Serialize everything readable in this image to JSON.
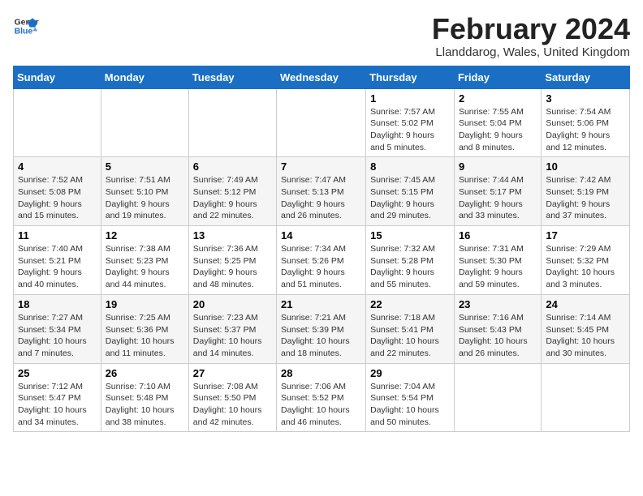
{
  "header": {
    "logo_general": "General",
    "logo_blue": "Blue",
    "month_title": "February 2024",
    "location": "Llanddarog, Wales, United Kingdom"
  },
  "weekdays": [
    "Sunday",
    "Monday",
    "Tuesday",
    "Wednesday",
    "Thursday",
    "Friday",
    "Saturday"
  ],
  "weeks": [
    [
      {
        "day": "",
        "info": ""
      },
      {
        "day": "",
        "info": ""
      },
      {
        "day": "",
        "info": ""
      },
      {
        "day": "",
        "info": ""
      },
      {
        "day": "1",
        "info": "Sunrise: 7:57 AM\nSunset: 5:02 PM\nDaylight: 9 hours\nand 5 minutes."
      },
      {
        "day": "2",
        "info": "Sunrise: 7:55 AM\nSunset: 5:04 PM\nDaylight: 9 hours\nand 8 minutes."
      },
      {
        "day": "3",
        "info": "Sunrise: 7:54 AM\nSunset: 5:06 PM\nDaylight: 9 hours\nand 12 minutes."
      }
    ],
    [
      {
        "day": "4",
        "info": "Sunrise: 7:52 AM\nSunset: 5:08 PM\nDaylight: 9 hours\nand 15 minutes."
      },
      {
        "day": "5",
        "info": "Sunrise: 7:51 AM\nSunset: 5:10 PM\nDaylight: 9 hours\nand 19 minutes."
      },
      {
        "day": "6",
        "info": "Sunrise: 7:49 AM\nSunset: 5:12 PM\nDaylight: 9 hours\nand 22 minutes."
      },
      {
        "day": "7",
        "info": "Sunrise: 7:47 AM\nSunset: 5:13 PM\nDaylight: 9 hours\nand 26 minutes."
      },
      {
        "day": "8",
        "info": "Sunrise: 7:45 AM\nSunset: 5:15 PM\nDaylight: 9 hours\nand 29 minutes."
      },
      {
        "day": "9",
        "info": "Sunrise: 7:44 AM\nSunset: 5:17 PM\nDaylight: 9 hours\nand 33 minutes."
      },
      {
        "day": "10",
        "info": "Sunrise: 7:42 AM\nSunset: 5:19 PM\nDaylight: 9 hours\nand 37 minutes."
      }
    ],
    [
      {
        "day": "11",
        "info": "Sunrise: 7:40 AM\nSunset: 5:21 PM\nDaylight: 9 hours\nand 40 minutes."
      },
      {
        "day": "12",
        "info": "Sunrise: 7:38 AM\nSunset: 5:23 PM\nDaylight: 9 hours\nand 44 minutes."
      },
      {
        "day": "13",
        "info": "Sunrise: 7:36 AM\nSunset: 5:25 PM\nDaylight: 9 hours\nand 48 minutes."
      },
      {
        "day": "14",
        "info": "Sunrise: 7:34 AM\nSunset: 5:26 PM\nDaylight: 9 hours\nand 51 minutes."
      },
      {
        "day": "15",
        "info": "Sunrise: 7:32 AM\nSunset: 5:28 PM\nDaylight: 9 hours\nand 55 minutes."
      },
      {
        "day": "16",
        "info": "Sunrise: 7:31 AM\nSunset: 5:30 PM\nDaylight: 9 hours\nand 59 minutes."
      },
      {
        "day": "17",
        "info": "Sunrise: 7:29 AM\nSunset: 5:32 PM\nDaylight: 10 hours\nand 3 minutes."
      }
    ],
    [
      {
        "day": "18",
        "info": "Sunrise: 7:27 AM\nSunset: 5:34 PM\nDaylight: 10 hours\nand 7 minutes."
      },
      {
        "day": "19",
        "info": "Sunrise: 7:25 AM\nSunset: 5:36 PM\nDaylight: 10 hours\nand 11 minutes."
      },
      {
        "day": "20",
        "info": "Sunrise: 7:23 AM\nSunset: 5:37 PM\nDaylight: 10 hours\nand 14 minutes."
      },
      {
        "day": "21",
        "info": "Sunrise: 7:21 AM\nSunset: 5:39 PM\nDaylight: 10 hours\nand 18 minutes."
      },
      {
        "day": "22",
        "info": "Sunrise: 7:18 AM\nSunset: 5:41 PM\nDaylight: 10 hours\nand 22 minutes."
      },
      {
        "day": "23",
        "info": "Sunrise: 7:16 AM\nSunset: 5:43 PM\nDaylight: 10 hours\nand 26 minutes."
      },
      {
        "day": "24",
        "info": "Sunrise: 7:14 AM\nSunset: 5:45 PM\nDaylight: 10 hours\nand 30 minutes."
      }
    ],
    [
      {
        "day": "25",
        "info": "Sunrise: 7:12 AM\nSunset: 5:47 PM\nDaylight: 10 hours\nand 34 minutes."
      },
      {
        "day": "26",
        "info": "Sunrise: 7:10 AM\nSunset: 5:48 PM\nDaylight: 10 hours\nand 38 minutes."
      },
      {
        "day": "27",
        "info": "Sunrise: 7:08 AM\nSunset: 5:50 PM\nDaylight: 10 hours\nand 42 minutes."
      },
      {
        "day": "28",
        "info": "Sunrise: 7:06 AM\nSunset: 5:52 PM\nDaylight: 10 hours\nand 46 minutes."
      },
      {
        "day": "29",
        "info": "Sunrise: 7:04 AM\nSunset: 5:54 PM\nDaylight: 10 hours\nand 50 minutes."
      },
      {
        "day": "",
        "info": ""
      },
      {
        "day": "",
        "info": ""
      }
    ]
  ]
}
